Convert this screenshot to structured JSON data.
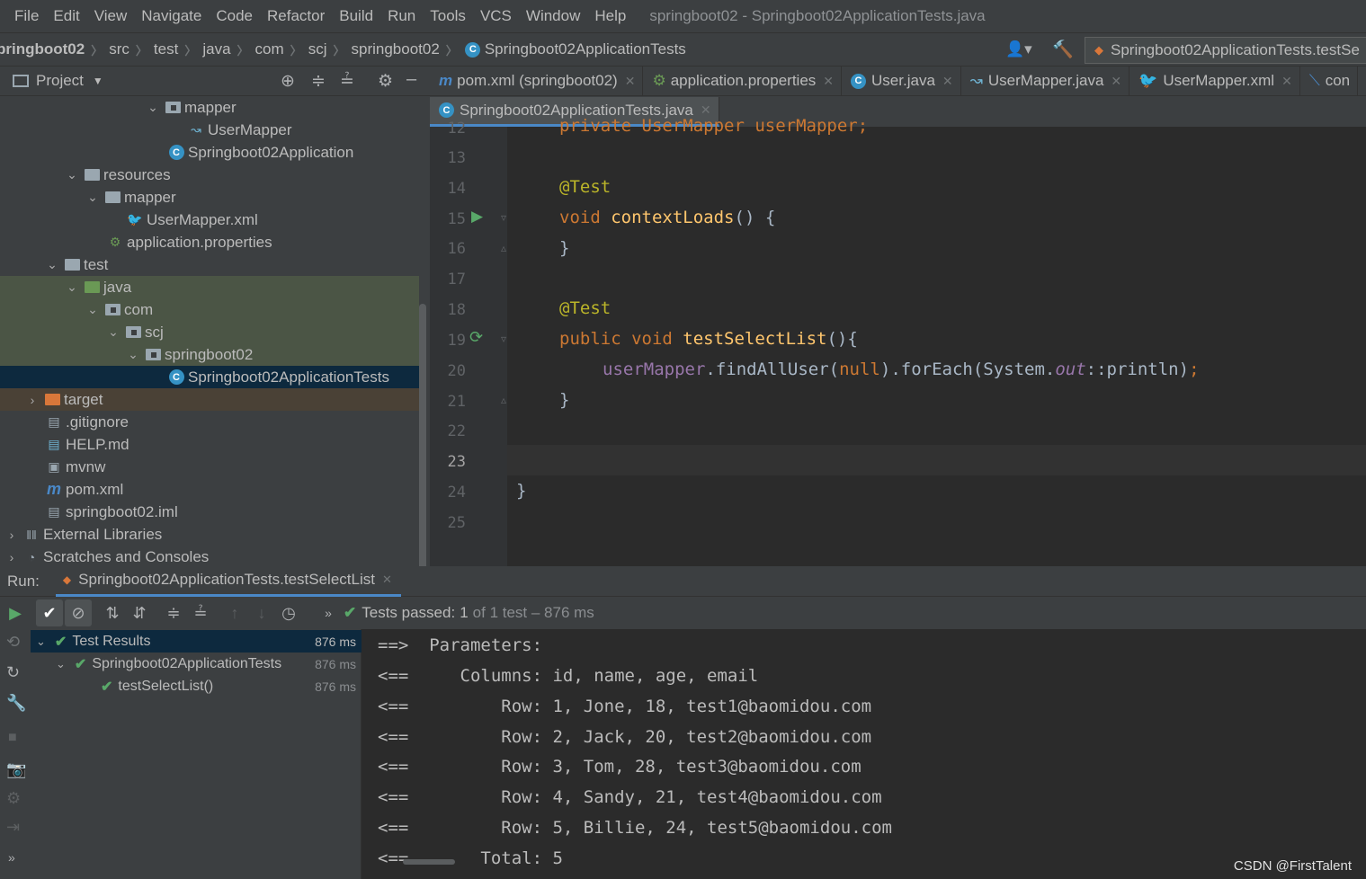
{
  "menu": [
    "File",
    "Edit",
    "View",
    "Navigate",
    "Code",
    "Refactor",
    "Build",
    "Run",
    "Tools",
    "VCS",
    "Window",
    "Help"
  ],
  "window_title": "springboot02 - Springboot02ApplicationTests.java",
  "breadcrumbs": [
    "pringboot02",
    "src",
    "test",
    "java",
    "com",
    "scj",
    "springboot02",
    "Springboot02ApplicationTests"
  ],
  "run_config": "Springboot02ApplicationTests.testSe",
  "project": {
    "title": "Project",
    "tree": [
      {
        "label": "mapper",
        "type": "folder"
      },
      {
        "label": "UserMapper",
        "type": "mapper-icon"
      },
      {
        "label": "Springboot02Application",
        "type": "class"
      },
      {
        "label": "resources",
        "type": "folder"
      },
      {
        "label": "mapper",
        "type": "folder"
      },
      {
        "label": "UserMapper.xml",
        "type": "xml"
      },
      {
        "label": "application.properties",
        "type": "props"
      },
      {
        "label": "test",
        "type": "folder"
      },
      {
        "label": "java",
        "type": "folder"
      },
      {
        "label": "com",
        "type": "package"
      },
      {
        "label": "scj",
        "type": "package"
      },
      {
        "label": "springboot02",
        "type": "package"
      },
      {
        "label": "Springboot02ApplicationTests",
        "type": "class"
      },
      {
        "label": "target",
        "type": "folder"
      },
      {
        "label": ".gitignore",
        "type": "file"
      },
      {
        "label": "HELP.md",
        "type": "md"
      },
      {
        "label": "mvnw",
        "type": "file"
      },
      {
        "label": "pom.xml",
        "type": "maven"
      },
      {
        "label": "springboot02.iml",
        "type": "file"
      },
      {
        "label": "External Libraries",
        "type": "lib"
      },
      {
        "label": "Scratches and Consoles",
        "type": "scratch"
      }
    ]
  },
  "tabs_row1": [
    "pom.xml (springboot02)",
    "application.properties",
    "User.java",
    "UserMapper.java",
    "UserMapper.xml",
    "con"
  ],
  "tabs_row2": [
    "Springboot02ApplicationTests.java"
  ],
  "editor": {
    "line_numbers": [
      "12",
      "13",
      "14",
      "15",
      "16",
      "17",
      "18",
      "19",
      "20",
      "21",
      "22",
      "23",
      "24",
      "25"
    ],
    "partial_line": "private UserMapper userMapper;",
    "annotation1": "@Test",
    "method1_kw": "void",
    "method1_name": "contextLoads",
    "method1_rest": "() {",
    "close1": "}",
    "annotation2": "@Test",
    "method2_kw": "public void",
    "method2_name": "testSelectList",
    "method2_rest": "(){",
    "body_field": "userMapper",
    "body_mid": ".findAllUser(",
    "body_null": "null",
    "body_rest": ").forEach(System.",
    "body_out": "out",
    "body_end": "::println)",
    "body_semi": ";",
    "close2": "}",
    "close_class": "}"
  },
  "run": {
    "label": "Run:",
    "tab": "Springboot02ApplicationTests.testSelectList",
    "status_prefix": "Tests passed:",
    "status_count": "1",
    "status_suffix": "of 1 test – 876 ms",
    "results": [
      {
        "label": "Test Results",
        "time": "876 ms"
      },
      {
        "label": "Springboot02ApplicationTests",
        "time": "876 ms"
      },
      {
        "label": "testSelectList()",
        "time": "876 ms"
      }
    ],
    "console": [
      "==>  Parameters: ",
      "<==     Columns: id, name, age, email",
      "<==         Row: 1, Jone, 18, test1@baomidou.com",
      "<==         Row: 2, Jack, 20, test2@baomidou.com",
      "<==         Row: 3, Tom, 28, test3@baomidou.com",
      "<==         Row: 4, Sandy, 21, test4@baomidou.com",
      "<==         Row: 5, Billie, 24, test5@baomidou.com",
      "<==       Total: 5"
    ]
  },
  "watermark": "CSDN @FirstTalent",
  "colors": {
    "keyword": "#cc7832",
    "method": "#ffc66d",
    "annotation": "#bbb529",
    "field": "#9876aa",
    "accent": "#4a88c7",
    "pass": "#59a869"
  }
}
